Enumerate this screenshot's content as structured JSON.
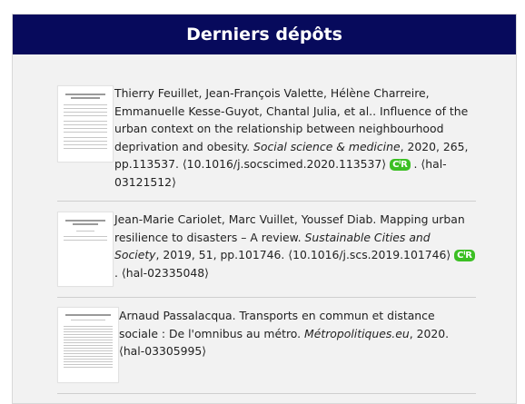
{
  "header": {
    "title": "Derniers dépôts"
  },
  "deposits": [
    {
      "authors": "Thierry Feuillet, Jean-François Valette, Hélène Charreire, Emmanuelle Kesse-Guyot, Chantal Julia, et al..",
      "title": "Influence of the urban context on the relationship between neighbourhood deprivation and obesity.",
      "journal": "Social science & medicine",
      "details": ", 2020, 265, pp.113537. ⟨10.1016/j.socscimed.2020.113537⟩",
      "badge": "CᴵR",
      "hal_id": ". ⟨hal-03121512⟩"
    },
    {
      "authors": "Jean-Marie Cariolet, Marc Vuillet, Youssef Diab.",
      "title": "Mapping urban resilience to disasters – A review.",
      "journal": "Sustainable Cities and Society",
      "details": ", 2019, 51, pp.101746. ⟨10.1016/j.scs.2019.101746⟩",
      "badge": "CᴵR",
      "hal_id": ". ⟨hal-02335048⟩"
    },
    {
      "authors": "Arnaud Passalacqua.",
      "title": "Transports en commun et distance sociale : De l'omnibus au métro.",
      "journal": "Métropolitiques.eu",
      "details": ", 2020. ⟨hal-03305995⟩"
    }
  ]
}
